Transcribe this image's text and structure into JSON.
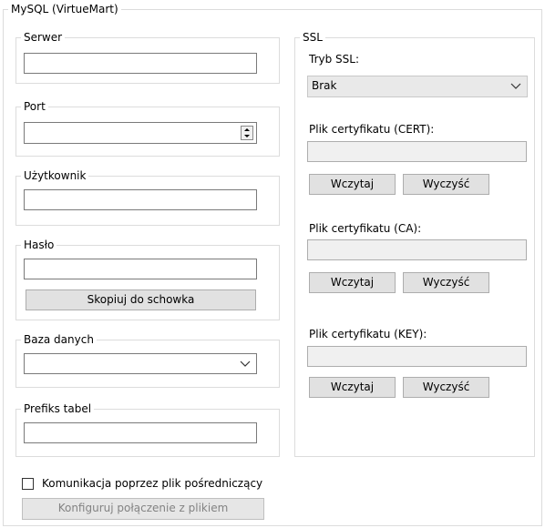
{
  "main_group": {
    "title": "MySQL (VirtueMart)"
  },
  "server": {
    "title": "Serwer",
    "value": ""
  },
  "port": {
    "title": "Port",
    "value": ""
  },
  "user": {
    "title": "Użytkownik",
    "value": ""
  },
  "password": {
    "title": "Hasło",
    "value": "",
    "copy_label": "Skopiuj do schowka"
  },
  "database": {
    "title": "Baza danych",
    "value": ""
  },
  "prefix": {
    "title": "Prefiks tabel",
    "value": ""
  },
  "ssl": {
    "title": "SSL",
    "mode_label": "Tryb SSL:",
    "mode_value": "Brak",
    "cert_label": "Plik certyfikatu (CERT):",
    "ca_label": "Plik certyfikatu (CA):",
    "key_label": "Plik certyfikatu (KEY):",
    "load_label": "Wczytaj",
    "clear_label": "Wyczyść"
  },
  "proxy": {
    "checkbox_label": "Komunikacja poprzez plik pośredniczący",
    "checked": false,
    "configure_label": "Konfiguruj połączenie z plikiem"
  }
}
